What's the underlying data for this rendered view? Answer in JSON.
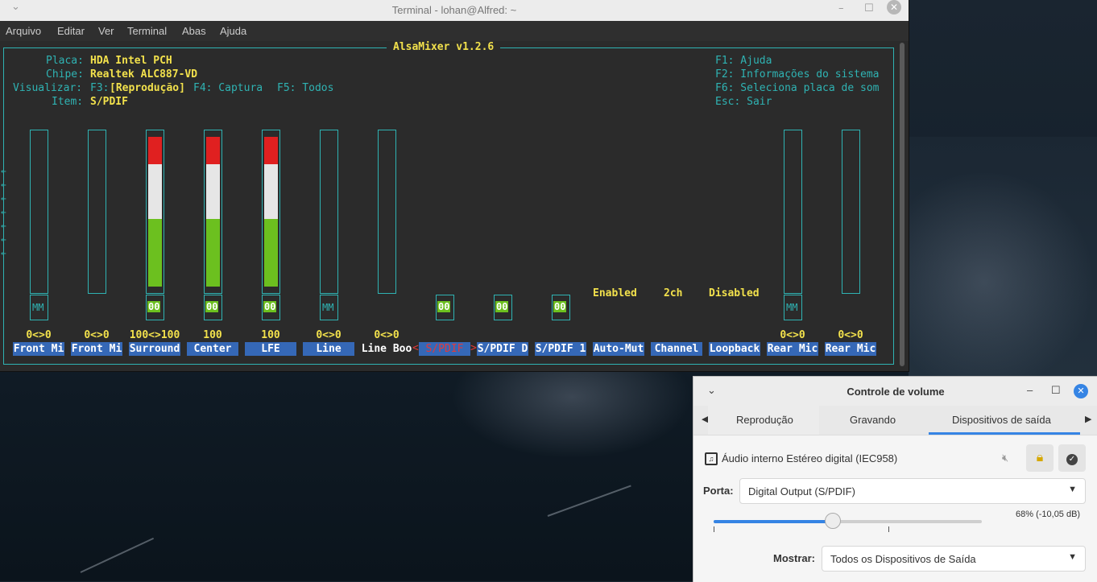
{
  "terminal": {
    "title": "Terminal - lohan@Alfred: ~",
    "menu": [
      "Arquivo",
      "Editar",
      "Ver",
      "Terminal",
      "Abas",
      "Ajuda"
    ]
  },
  "alsamixer": {
    "title": "AlsaMixer v1.2.6",
    "info": {
      "placa_label": "Placa:",
      "placa_value": "HDA Intel PCH",
      "chipe_label": "Chipe:",
      "chipe_value": "Realtek ALC887-VD",
      "view_label": "Visualizar:",
      "view_f3_key": "F3:",
      "view_f3": "[Reprodução]",
      "view_f4": "F4: Captura",
      "view_f5": "F5: Todos",
      "item_label": "Item:",
      "item_value": "S/PDIF"
    },
    "help": [
      "F1: Ajuda",
      "F2: Informações do sistema",
      "F6: Seleciona placa de som",
      "Esc: Sair"
    ],
    "controls": [
      {
        "name": "Front Mi",
        "value": "0<>0",
        "state": "MM",
        "level": 0
      },
      {
        "name": "Front Mi",
        "value": "0<>0",
        "state": "",
        "level": 0
      },
      {
        "name": "Surround",
        "value": "100<>100",
        "state": "00",
        "level": 100
      },
      {
        "name": "Center",
        "value": "100",
        "state": "00",
        "level": 100
      },
      {
        "name": "LFE",
        "value": "100",
        "state": "00",
        "level": 100
      },
      {
        "name": "Line",
        "value": "0<>0",
        "state": "MM",
        "level": 0
      },
      {
        "name": "Line Boo",
        "value": "0<>0",
        "state": "",
        "level": 0
      },
      {
        "name": "S/PDIF",
        "value": "",
        "state": "00",
        "level": null,
        "selected": true
      },
      {
        "name": "S/PDIF D",
        "value": "",
        "state": "00",
        "level": null
      },
      {
        "name": "S/PDIF 1",
        "value": "",
        "state": "00",
        "level": null
      },
      {
        "name": "Auto-Mut",
        "value": "Enabled",
        "state": "",
        "level": null
      },
      {
        "name": "Channel",
        "value": "2ch",
        "state": "",
        "level": null
      },
      {
        "name": "Loopback",
        "value": "Disabled",
        "state": "",
        "level": null
      },
      {
        "name": "Rear Mic",
        "value": "0<>0",
        "state": "MM",
        "level": 0
      },
      {
        "name": "Rear Mic",
        "value": "0<>0",
        "state": "",
        "level": 0
      }
    ]
  },
  "volume": {
    "title": "Controle de volume",
    "tabs": [
      "Reprodução",
      "Gravando",
      "Dispositivos de saída"
    ],
    "active_tab": 2,
    "device": "Áudio interno Estéreo digital (IEC958)",
    "port_label": "Porta:",
    "port_value": "Digital Output (S/PDIF)",
    "level_text": "68% (-10,05 dB)",
    "level_fraction": 0.68,
    "show_label": "Mostrar:",
    "show_value": "Todos os Dispositivos de Saída",
    "accent": "#3584e4"
  }
}
